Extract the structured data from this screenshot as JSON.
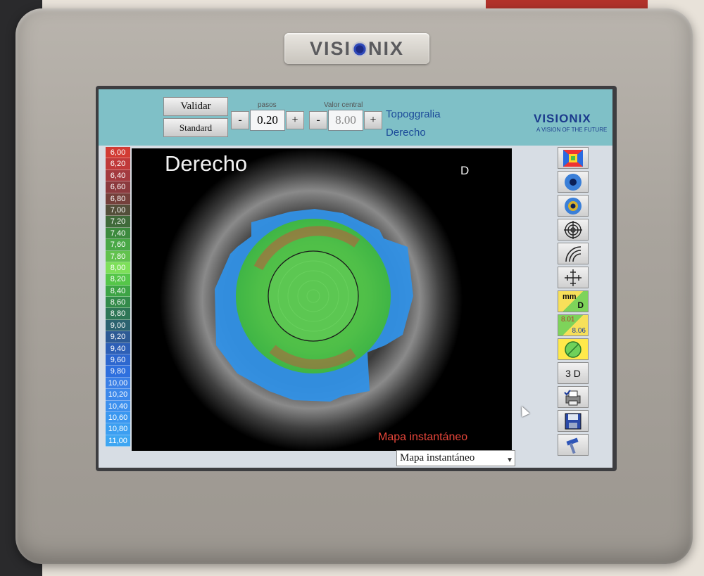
{
  "device": {
    "brand": "VISIONIX"
  },
  "toolbar": {
    "validate_label": "Validar",
    "standard_label": "Standard",
    "steps": {
      "label": "pasos",
      "value": "0.20",
      "minus": "-",
      "plus": "+"
    },
    "central_value": {
      "label": "Valor central",
      "value": "8.00",
      "minus": "-",
      "plus": "+"
    },
    "mode_line1": "Topoggralia",
    "mode_line2": "Derecho",
    "logo": "VISIONIX",
    "tagline": "A VISION OF THE FUTURE"
  },
  "scale": {
    "values": [
      "6,00",
      "6,20",
      "6,40",
      "6,60",
      "6,80",
      "7,00",
      "7,20",
      "7,40",
      "7,60",
      "7,80",
      "8,00",
      "8,20",
      "8,40",
      "8,60",
      "8,80",
      "9,00",
      "9,20",
      "9,40",
      "9,60",
      "9,80",
      "10,00",
      "10,20",
      "10,40",
      "10,60",
      "10,80",
      "11,00"
    ],
    "colors": [
      "#d23b34",
      "#c0393a",
      "#a33a3f",
      "#8b3a3e",
      "#74403b",
      "#534f3a",
      "#3f6a3a",
      "#3c8a3e",
      "#49a846",
      "#62c24e",
      "#7ee05a",
      "#55c649",
      "#3da445",
      "#338b4a",
      "#2e7656",
      "#2c6270",
      "#2d5a95",
      "#2d5fb6",
      "#2d67cf",
      "#2e6fde",
      "#3a7fe6",
      "#3c88ea",
      "#3c90ee",
      "#3a97f0",
      "#3c9ff1",
      "#3ea6f2"
    ]
  },
  "map": {
    "title": "Derecho",
    "eye": "D",
    "type_label": "Mapa instantáneo"
  },
  "tools": {
    "mm_label": "mm",
    "d_label": "D",
    "val1": "8.01",
    "val2": "8.06",
    "three_d": "3 D"
  },
  "select": {
    "value": "Mapa instantáneo"
  }
}
